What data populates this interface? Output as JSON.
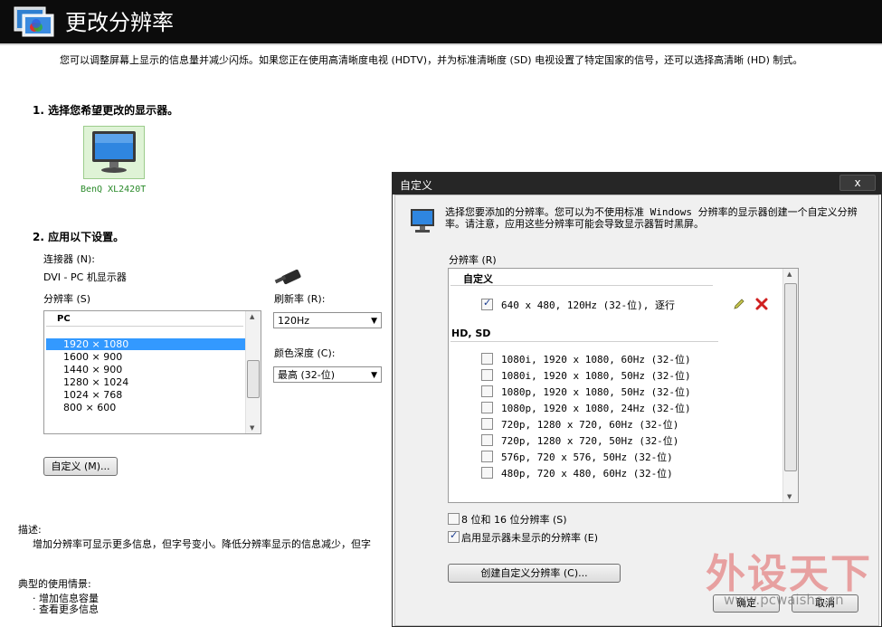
{
  "header": {
    "title": "更改分辨率"
  },
  "intro": "您可以调整屏幕上显示的信息量并减少闪烁。如果您正在使用高清晰度电视 (HDTV)，并为标准清晰度 (SD) 电视设置了特定国家的信号，还可以选择高清晰 (HD) 制式。",
  "step1": {
    "title": "1. 选择您希望更改的显示器。",
    "monitor_label": "BenQ XL2420T"
  },
  "step2": {
    "title": "2. 应用以下设置。",
    "connector_label": "连接器 (N):",
    "connector_value": "DVI - PC 机显示器",
    "resolution_label": "分辨率 (S)",
    "resolution_group": "PC",
    "resolutions": [
      "1920 × 1080",
      "1600 × 900",
      "1440 × 900",
      "1280 × 1024",
      "1024 × 768",
      "800 × 600"
    ],
    "refresh_label": "刷新率 (R):",
    "refresh_value": "120Hz",
    "depth_label": "颜色深度 (C):",
    "depth_value": "最高 (32-位)",
    "custom_button": "自定义 (M)..."
  },
  "description": {
    "title": "描述:",
    "text": "增加分辨率可显示更多信息，但字号变小。降低分辨率显示的信息减少，但字"
  },
  "usage": {
    "title": "典型的使用情景:",
    "items": [
      "· 增加信息容量",
      "· 查看更多信息"
    ]
  },
  "dialog": {
    "title": "自定义",
    "close": "x",
    "description": "选择您要添加的分辨率。您可以为不使用标准 Windows 分辨率的显示器创建一个自定义分辨率。请注意，应用这些分辨率可能会导致显示器暂时黑屏。",
    "res_label": "分辨率 (R)",
    "group_custom": "自定义",
    "custom_item": "640 x 480, 120Hz (32-位), 逐行",
    "group_hd": "HD, SD",
    "hd_items": [
      "1080i, 1920 x 1080, 60Hz (32-位)",
      "1080i, 1920 x 1080, 50Hz (32-位)",
      "1080p, 1920 x 1080, 50Hz (32-位)",
      "1080p, 1920 x 1080, 24Hz (32-位)",
      "720p, 1280 x 720, 60Hz (32-位)",
      "720p, 1280 x 720, 50Hz (32-位)",
      "576p, 720 x 576, 50Hz (32-位)",
      "480p, 720 x 480, 60Hz (32-位)"
    ],
    "opt_8_16": "8 位和 16 位分辨率 (S)",
    "opt_hidden": "启用显示器未显示的分辨率 (E)",
    "create_button": "创建自定义分辨率 (C)...",
    "ok_button": "确定",
    "cancel_button": "取消"
  },
  "watermark": {
    "text": "外设天下",
    "url": "www.pcwaishe.cn"
  }
}
